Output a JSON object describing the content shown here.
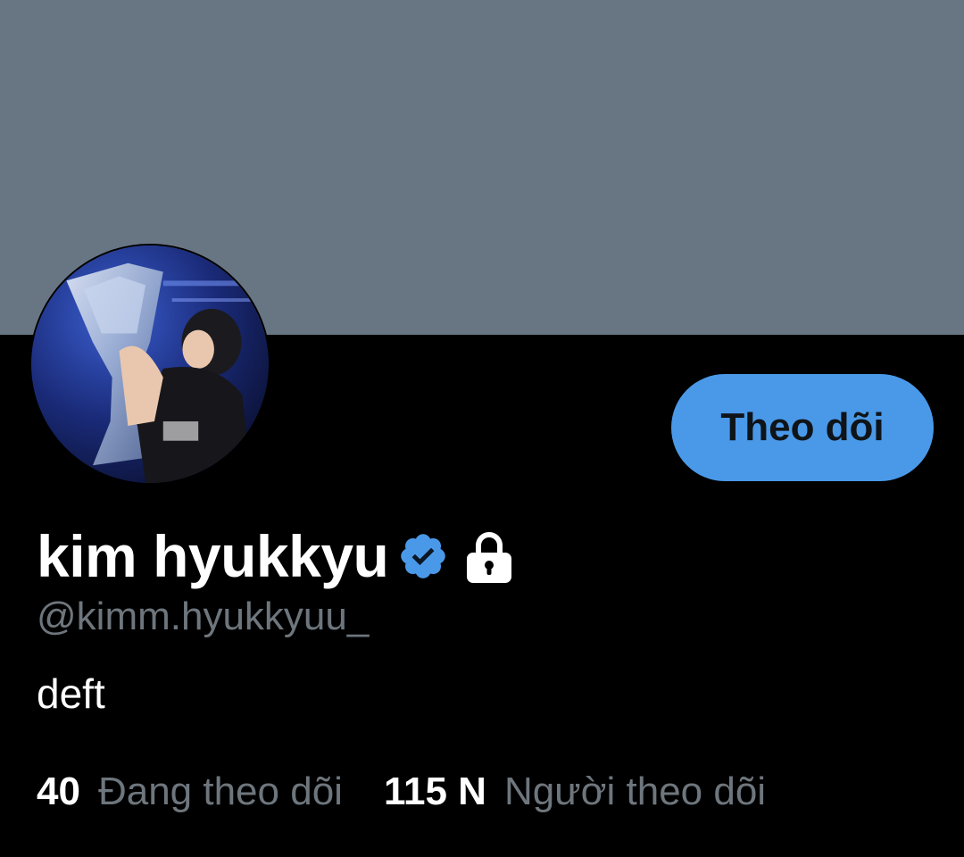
{
  "profile": {
    "display_name": "kim hyukkyu",
    "handle": "@kimm.hyukkyuu_",
    "bio": "deft",
    "verified_icon": "verified-badge-icon",
    "protected_icon": "lock-icon",
    "avatar_alt": "profile avatar photo"
  },
  "actions": {
    "follow_label": "Theo dõi"
  },
  "stats": {
    "following_count": "40",
    "following_label": "Đang theo dõi",
    "followers_count": "115 N",
    "followers_label": "Người theo dõi"
  },
  "colors": {
    "banner": "#687684",
    "background": "#000000",
    "accent": "#4a99e9",
    "secondary_text": "#6e767d"
  }
}
